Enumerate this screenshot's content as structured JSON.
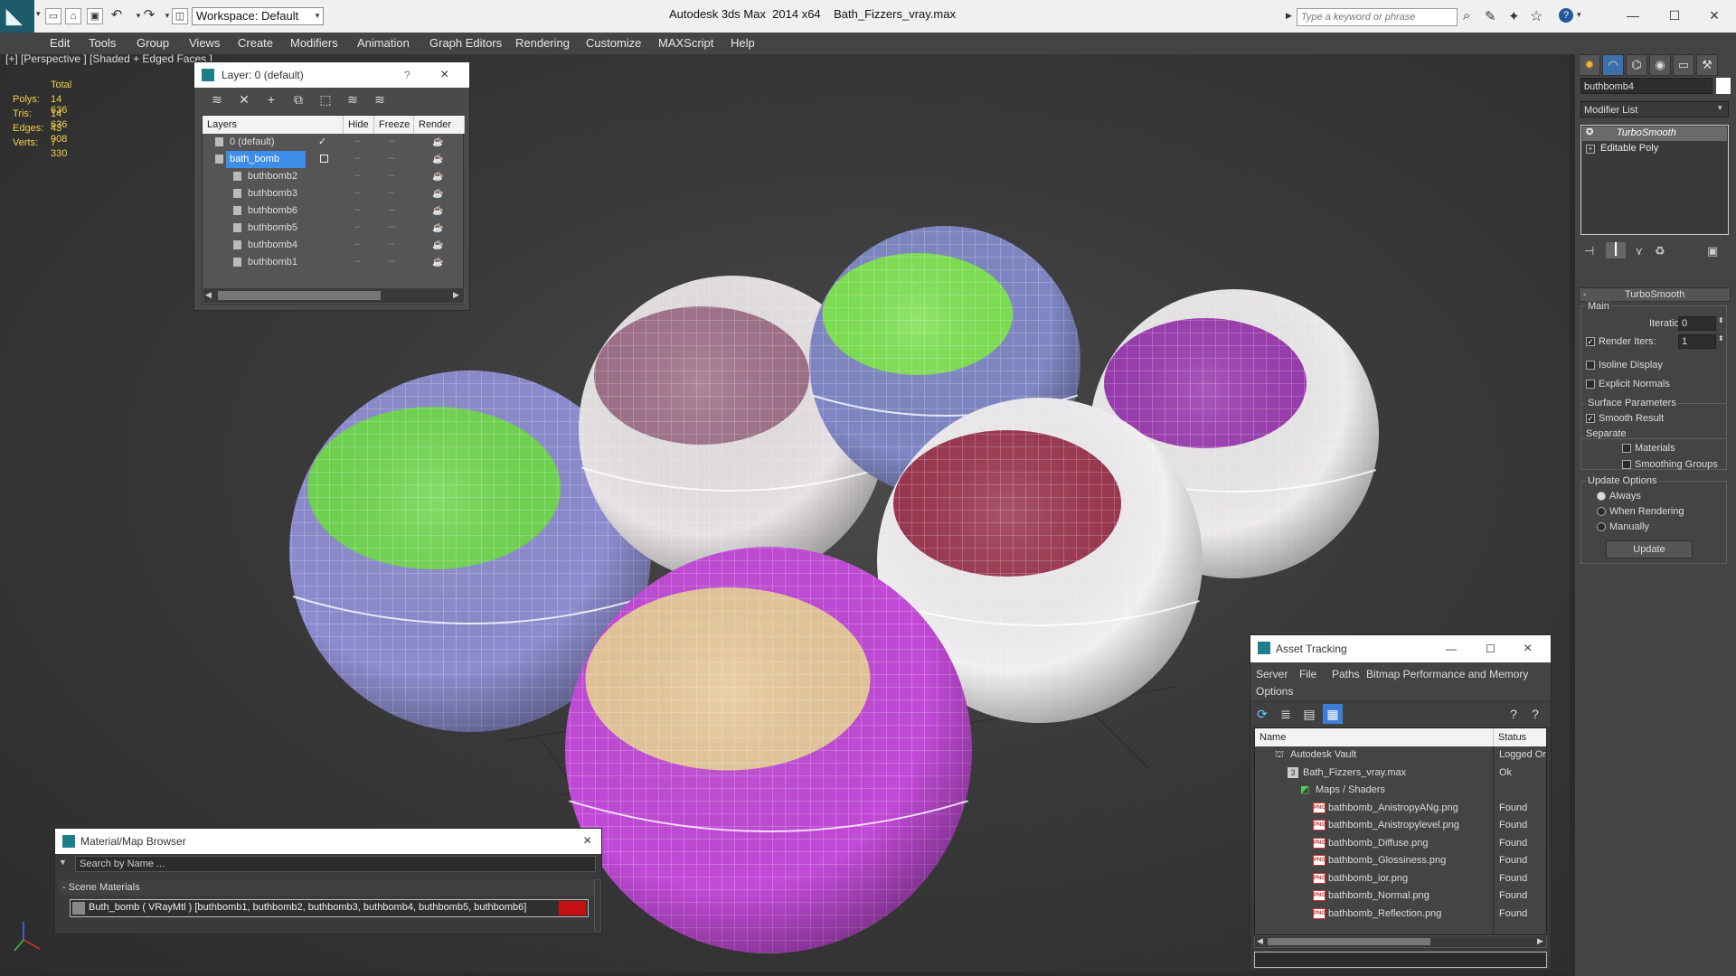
{
  "titlebar": {
    "workspace": "Workspace: Default",
    "app_title": "Autodesk 3ds Max  2014 x64",
    "file_name": "Bath_Fizzers_vray.max",
    "search_placeholder": "Type a keyword or phrase"
  },
  "menu": [
    "Edit",
    "Tools",
    "Group",
    "Views",
    "Create",
    "Modifiers",
    "Animation",
    "Graph Editors",
    "Rendering",
    "Customize",
    "MAXScript",
    "Help"
  ],
  "viewport": {
    "label": "[+] [Perspective ] [Shaded + Edged Faces ]",
    "stats": {
      "header": "Total",
      "rows": [
        {
          "label": "Polys:",
          "value": "14 636"
        },
        {
          "label": "Tris:",
          "value": "14 636"
        },
        {
          "label": "Edges:",
          "value": "43 908"
        },
        {
          "label": "Verts:",
          "value": "7 330"
        }
      ]
    },
    "bombs": [
      {
        "primary": "#8c8ccf",
        "secondary": "#6fd64e"
      },
      {
        "primary": "#e6e2e4",
        "secondary": "#a07088"
      },
      {
        "primary": "#7f87c4",
        "secondary": "#7de251"
      },
      {
        "primary": "#ece9eb",
        "secondary": "#9a3ab0"
      },
      {
        "primary": "#f0eef0",
        "secondary": "#9b3550"
      },
      {
        "primary": "#c24ad8",
        "secondary": "#e8c79a"
      }
    ]
  },
  "layer_dialog": {
    "title": "Layer: 0 (default)",
    "help": "?",
    "close": "×",
    "columns": {
      "layers": "Layers",
      "hide": "Hide",
      "freeze": "Freeze",
      "render": "Render"
    },
    "rows": [
      {
        "name": "0 (default)",
        "indent": 0,
        "selected": false,
        "active": true
      },
      {
        "name": "bath_bomb",
        "indent": 0,
        "selected": true,
        "active": false
      },
      {
        "name": "buthbomb2",
        "indent": 1,
        "selected": false,
        "active": false
      },
      {
        "name": "buthbomb3",
        "indent": 1,
        "selected": false,
        "active": false
      },
      {
        "name": "buthbomb6",
        "indent": 1,
        "selected": false,
        "active": false
      },
      {
        "name": "buthbomb5",
        "indent": 1,
        "selected": false,
        "active": false
      },
      {
        "name": "buthbomb4",
        "indent": 1,
        "selected": false,
        "active": false
      },
      {
        "name": "buthbomb1",
        "indent": 1,
        "selected": false,
        "active": false
      }
    ]
  },
  "material_browser": {
    "title": "Material/Map Browser",
    "search_placeholder": "Search by Name ...",
    "section": "- Scene Materials",
    "item": "Buth_bomb  ( VRayMtl ) [buthbomb1, buthbomb2, buthbomb3, buthbomb4, buthbomb5, buthbomb6]",
    "close": "×"
  },
  "asset_tracking": {
    "title": "Asset Tracking",
    "menu": [
      "Server",
      "File",
      "Paths",
      "Bitmap Performance and Memory",
      "Options"
    ],
    "columns": {
      "name": "Name",
      "status": "Status"
    },
    "rows": [
      {
        "name": "Autodesk Vault",
        "status": "Logged Or",
        "indent": 1,
        "icon": "vault"
      },
      {
        "name": "Bath_Fizzers_vray.max",
        "status": "Ok",
        "indent": 2,
        "icon": "max"
      },
      {
        "name": "Maps / Shaders",
        "status": "",
        "indent": 3,
        "icon": "maps"
      },
      {
        "name": "bathbomb_AnistropyANg.png",
        "status": "Found",
        "indent": 4,
        "icon": "png"
      },
      {
        "name": "bathbomb_Anistropylevel.png",
        "status": "Found",
        "indent": 4,
        "icon": "png"
      },
      {
        "name": "bathbomb_Diffuse.png",
        "status": "Found",
        "indent": 4,
        "icon": "png"
      },
      {
        "name": "bathbomb_Glossiness.png",
        "status": "Found",
        "indent": 4,
        "icon": "png"
      },
      {
        "name": "bathbomb_ior.png",
        "status": "Found",
        "indent": 4,
        "icon": "png"
      },
      {
        "name": "bathbomb_Normal.png",
        "status": "Found",
        "indent": 4,
        "icon": "png"
      },
      {
        "name": "bathbomb_Reflection.png",
        "status": "Found",
        "indent": 4,
        "icon": "png"
      }
    ]
  },
  "command_panel": {
    "object_name": "buthbomb4",
    "modifier_list": "Modifier List",
    "stack": [
      "TurboSmooth",
      "Editable Poly"
    ],
    "rollout_title": "TurboSmooth",
    "main_label": "Main",
    "iterations_label": "Iterations:",
    "iterations_value": "0",
    "render_iters_label": "Render Iters:",
    "render_iters_value": "1",
    "isoline_display": "Isoline Display",
    "explicit_normals": "Explicit Normals",
    "surface_params": "Surface Parameters",
    "smooth_result": "Smooth Result",
    "separate": "Separate",
    "materials": "Materials",
    "smoothing_groups": "Smoothing Groups",
    "update_options": "Update Options",
    "always": "Always",
    "when_rendering": "When Rendering",
    "manually": "Manually",
    "update_button": "Update"
  }
}
